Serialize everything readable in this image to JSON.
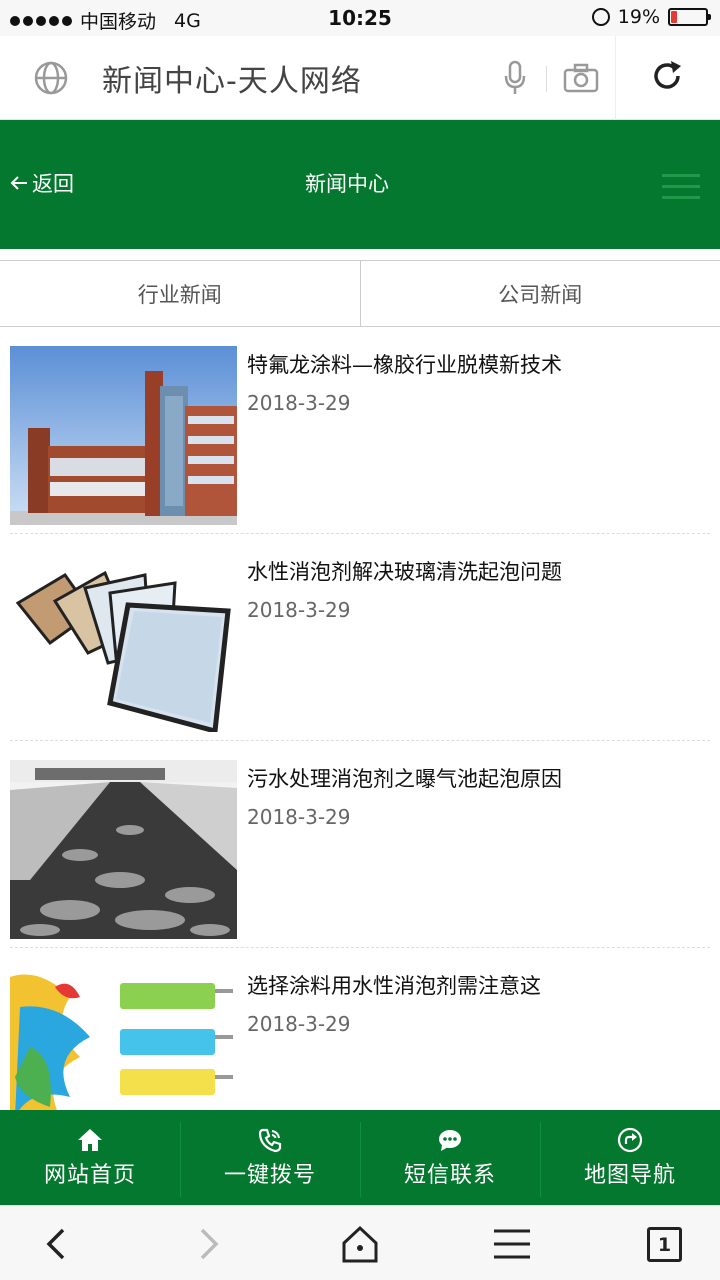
{
  "status_bar": {
    "carrier": "中国移动",
    "network": "4G",
    "time": "10:25",
    "battery_percent": "19%",
    "battery_level": 0.19
  },
  "url_bar": {
    "title": "新闻中心-天人网络",
    "icons": [
      "globe-icon",
      "microphone-icon",
      "camera-icon",
      "reload-icon"
    ]
  },
  "header": {
    "back_label": "返回",
    "title": "新闻中心",
    "menu_icon": "hamburger-icon",
    "color": "#05782f"
  },
  "tabs": [
    {
      "label": "行业新闻"
    },
    {
      "label": "公司新闻"
    }
  ],
  "news": [
    {
      "title": "特氟龙涂料—橡胶行业脱模新技术",
      "date": "2018-3-29",
      "image": "building-photo"
    },
    {
      "title": "水性消泡剂解决玻璃清洗起泡问题",
      "date": "2018-3-29",
      "image": "glass-panels-photo"
    },
    {
      "title": "污水处理消泡剂之曝气池起泡原因",
      "date": "2018-3-29",
      "image": "aeration-tank-photo"
    },
    {
      "title": "选择涂料用水性消泡剂需注意这",
      "date": "2018-3-29",
      "image": "paint-rollers-photo"
    }
  ],
  "footer_nav": [
    {
      "label": "网站首页",
      "icon": "home-icon"
    },
    {
      "label": "一键拨号",
      "icon": "phone-icon"
    },
    {
      "label": "短信联系",
      "icon": "message-icon"
    },
    {
      "label": "地图导航",
      "icon": "navigation-icon"
    }
  ],
  "toolbar": {
    "tab_count": "1",
    "icons": [
      "back-icon",
      "forward-icon",
      "home-icon",
      "menu-icon",
      "tabs-icon"
    ]
  }
}
